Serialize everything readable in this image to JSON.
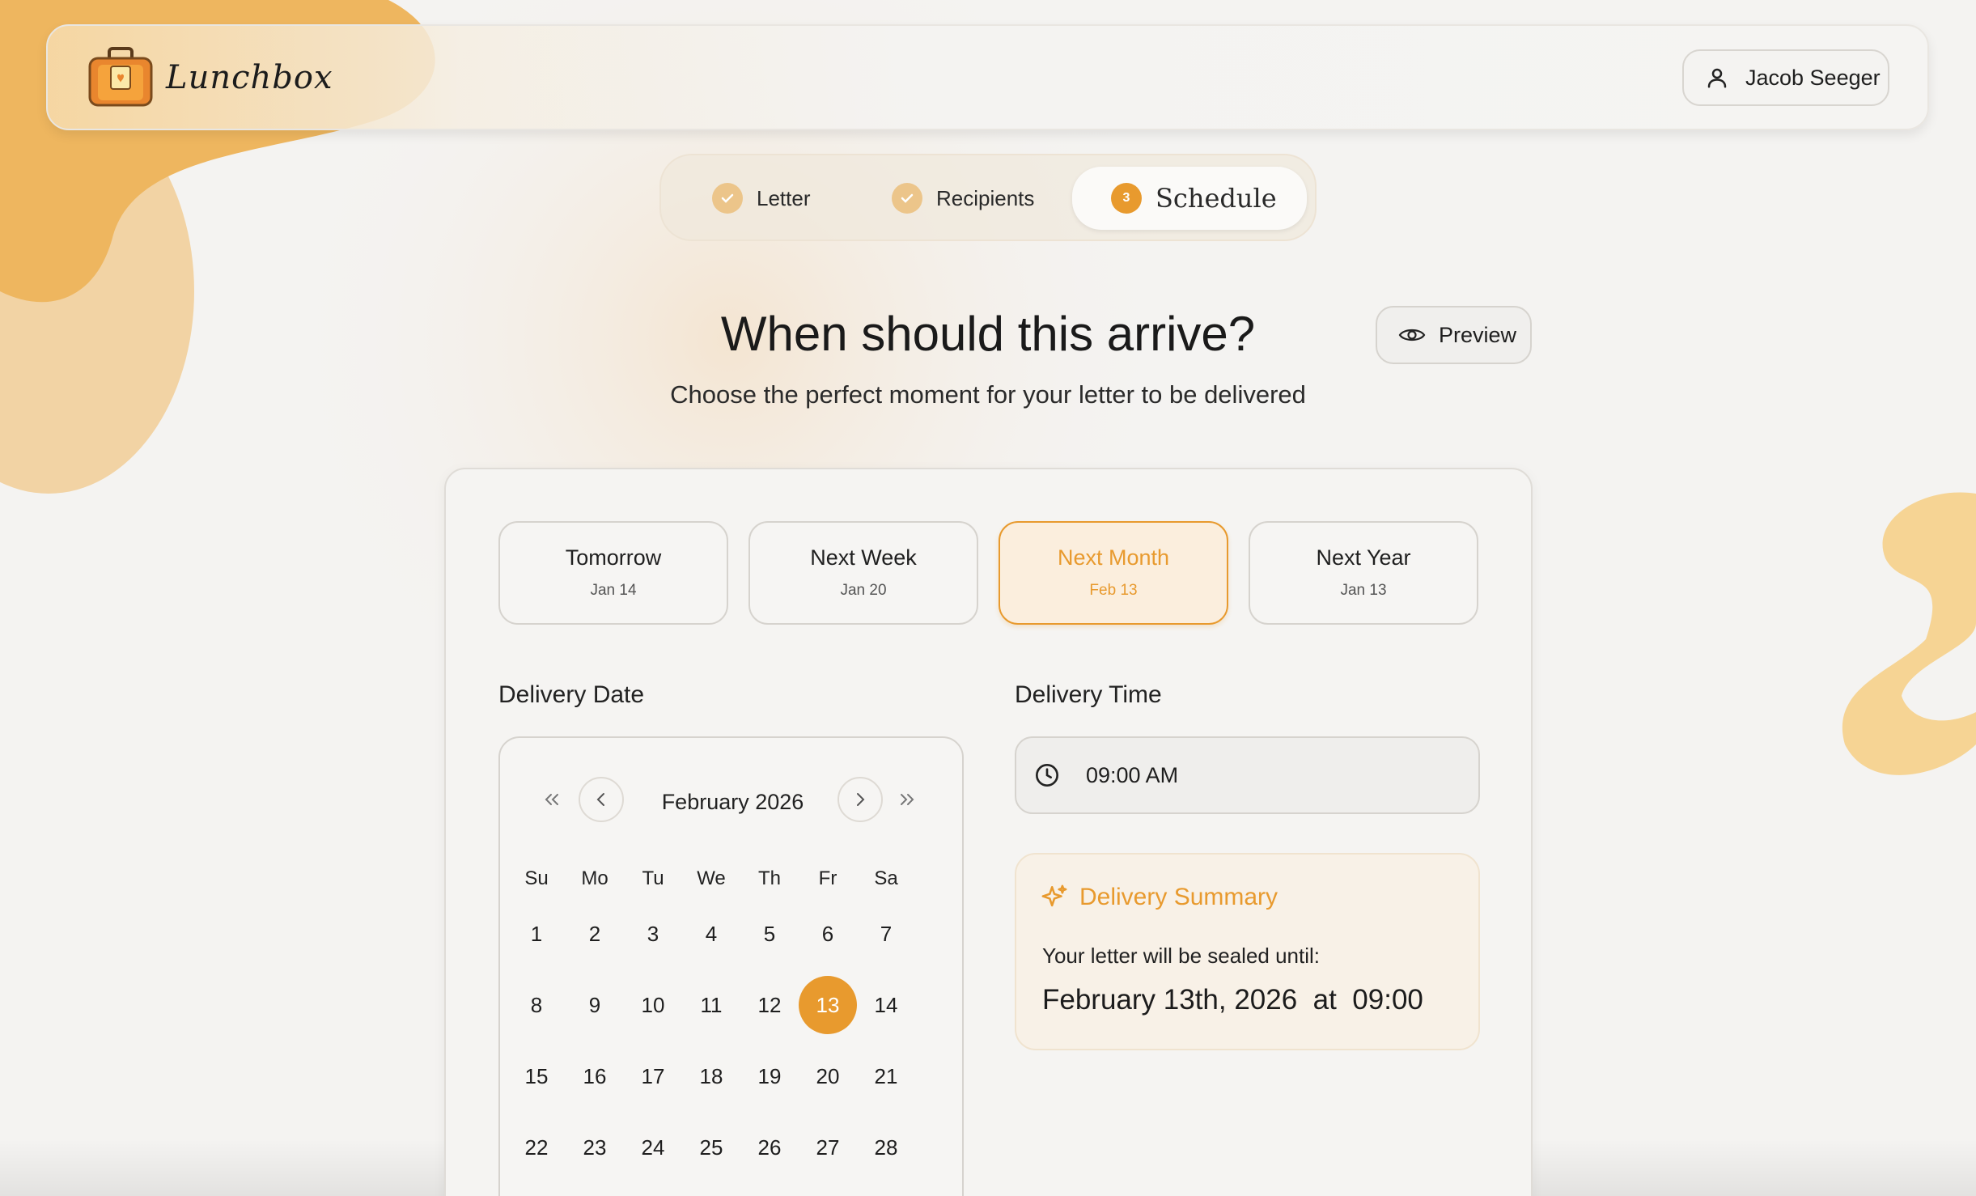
{
  "app": {
    "name": "Lunchbox"
  },
  "user": {
    "name": "Jacob Seeger"
  },
  "stepper": {
    "steps": [
      {
        "label": "Letter",
        "state": "done"
      },
      {
        "label": "Recipients",
        "state": "done"
      },
      {
        "label": "Schedule",
        "state": "current",
        "number": "3"
      }
    ]
  },
  "heading": {
    "title": "When should this arrive?",
    "subtitle": "Choose the perfect moment for your letter to be delivered"
  },
  "preview": {
    "label": "Preview"
  },
  "quick_options": [
    {
      "label": "Tomorrow",
      "date": "Jan 14",
      "selected": false
    },
    {
      "label": "Next Week",
      "date": "Jan 20",
      "selected": false
    },
    {
      "label": "Next Month",
      "date": "Feb 13",
      "selected": true
    },
    {
      "label": "Next Year",
      "date": "Jan 13",
      "selected": false
    }
  ],
  "delivery_date": {
    "label": "Delivery Date",
    "month_label": "February 2026",
    "weekdays": [
      "Su",
      "Mo",
      "Tu",
      "We",
      "Th",
      "Fr",
      "Sa"
    ],
    "weeks": [
      [
        "1",
        "2",
        "3",
        "4",
        "5",
        "6",
        "7"
      ],
      [
        "8",
        "9",
        "10",
        "11",
        "12",
        "13",
        "14"
      ],
      [
        "15",
        "16",
        "17",
        "18",
        "19",
        "20",
        "21"
      ],
      [
        "22",
        "23",
        "24",
        "25",
        "26",
        "27",
        "28"
      ]
    ],
    "selected_day": "13"
  },
  "delivery_time": {
    "label": "Delivery Time",
    "value": "09:00 AM"
  },
  "summary": {
    "title": "Delivery Summary",
    "line": "Your letter will be sealed until:",
    "date": "February 13th, 2026  at  09:00"
  },
  "colors": {
    "accent": "#e89a2e",
    "accent_soft": "#ecc58a",
    "background": "#f4f3f1"
  },
  "icons": {
    "user": "user-icon",
    "check": "check-icon",
    "eye": "eye-icon",
    "clock": "clock-icon",
    "sparkle": "sparkle-icon",
    "nav": [
      "double-chevron-left-icon",
      "chevron-left-icon",
      "chevron-right-icon",
      "double-chevron-right-icon"
    ]
  }
}
